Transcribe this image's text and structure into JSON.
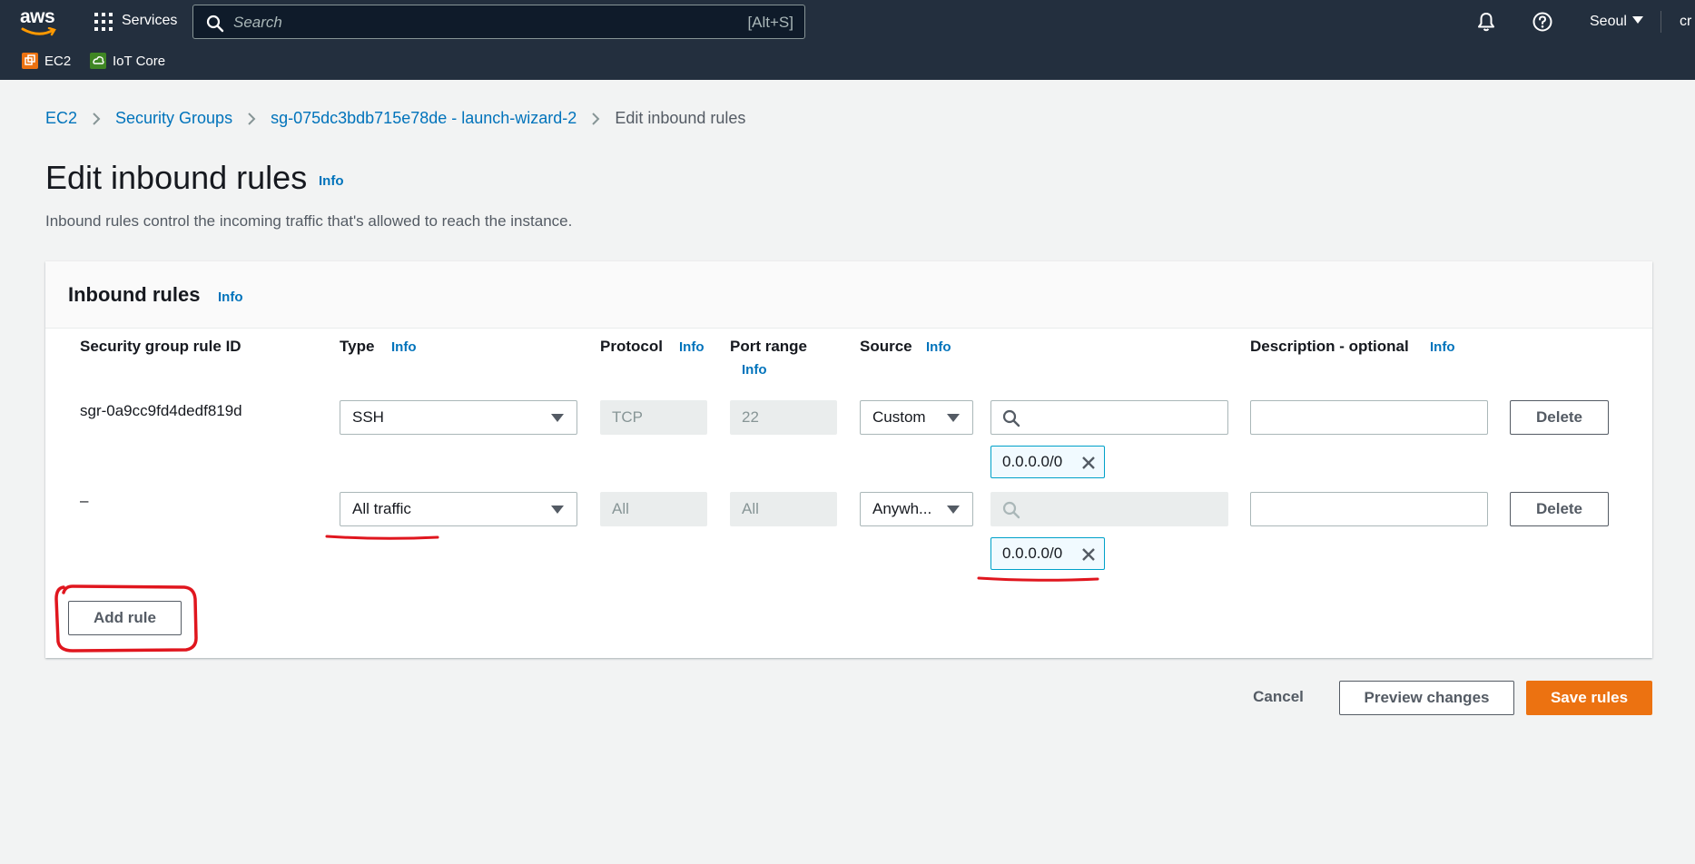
{
  "topnav": {
    "logo_text": "aws",
    "services_label": "Services",
    "search_placeholder": "Search",
    "search_shortcut": "[Alt+S]",
    "region": "Seoul",
    "user_initials": "cr",
    "favorites": [
      {
        "label": "EC2",
        "icon": "ec2-icon",
        "color": "#ec7211"
      },
      {
        "label": "IoT Core",
        "icon": "iot-core-icon",
        "color": "#3f8624"
      }
    ],
    "icons": [
      "grid-icon",
      "search-icon",
      "bell-icon",
      "help-icon",
      "chevron-down-icon"
    ]
  },
  "breadcrumb": {
    "items": [
      "EC2",
      "Security Groups",
      "sg-075dc3bdb715e78de - launch-wizard-2"
    ],
    "current": "Edit inbound rules"
  },
  "page": {
    "title": "Edit inbound rules",
    "info": "Info",
    "description": "Inbound rules control the incoming traffic that's allowed to reach the instance."
  },
  "panel": {
    "title": "Inbound rules",
    "info": "Info",
    "columns": {
      "rule_id": "Security group rule ID",
      "type": "Type",
      "protocol": "Protocol",
      "port_range": "Port range",
      "source": "Source",
      "description": "Description - optional",
      "info": "Info"
    },
    "rules": [
      {
        "rule_id": "sgr-0a9cc9fd4dedf819d",
        "type": "SSH",
        "protocol": "TCP",
        "port_range": "22",
        "source_type": "Custom",
        "source_search": "",
        "cidr": "0.0.0.0/0",
        "description": "",
        "delete_label": "Delete"
      },
      {
        "rule_id": "–",
        "type": "All traffic",
        "protocol": "All",
        "port_range": "All",
        "source_type": "Anywh...",
        "source_search": "",
        "cidr": "0.0.0.0/0",
        "description": "",
        "delete_label": "Delete"
      }
    ],
    "add_rule_label": "Add rule"
  },
  "footer": {
    "cancel": "Cancel",
    "preview": "Preview changes",
    "save": "Save rules"
  },
  "colors": {
    "nav_bg": "#232f3e",
    "link": "#0073bb",
    "primary": "#ec7211",
    "annotation": "#e0161e"
  }
}
